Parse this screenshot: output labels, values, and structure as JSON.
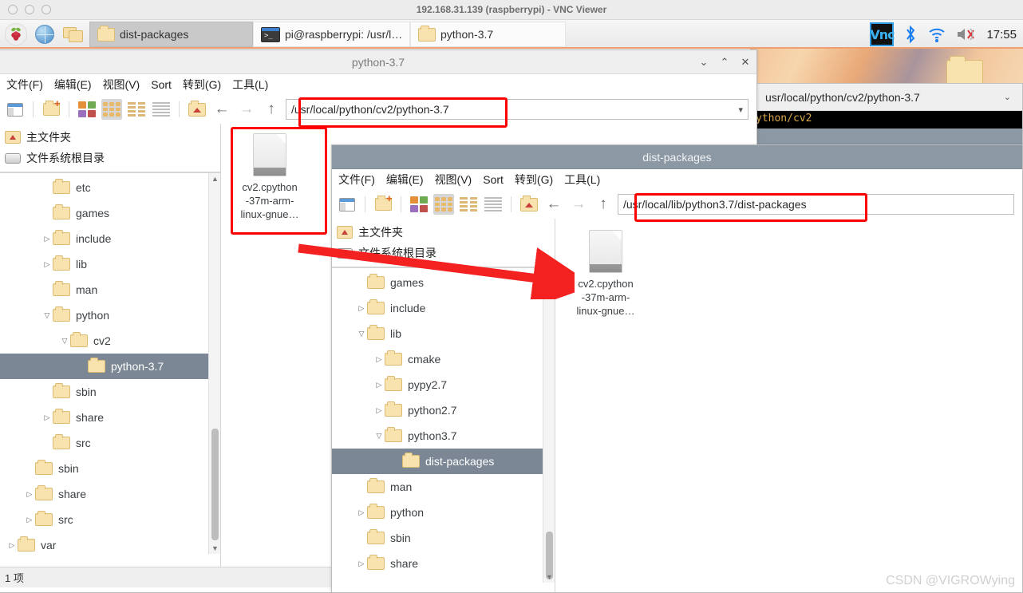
{
  "vnc": {
    "title": "192.168.31.139 (raspberrypi) - VNC Viewer",
    "dot_labels": [
      "minimize",
      "maximize",
      "close"
    ]
  },
  "taskbar": {
    "launchers": [
      {
        "name": "raspberry-menu",
        "icon": "raspberry-icon"
      },
      {
        "name": "web-browser",
        "icon": "globe-icon"
      },
      {
        "name": "file-manager",
        "icon": "folders-icon"
      },
      {
        "name": "terminal",
        "icon": "terminal-icon"
      }
    ],
    "tasks": [
      {
        "label": "dist-packages",
        "icon": "folder-icon",
        "state": "active"
      },
      {
        "label": "pi@raspberrypi: /usr/l…",
        "icon": "terminal-icon",
        "state": "normal"
      },
      {
        "label": "python-3.7",
        "icon": "folder-icon",
        "state": "normal"
      }
    ],
    "tray": {
      "vnc_label": "Vnc",
      "bluetooth_icon": "bluetooth-icon",
      "wifi_icon": "wifi-icon",
      "volume_icon": "volume-muted-icon",
      "clock": "17:55"
    }
  },
  "window_python37": {
    "title": "python-3.7",
    "buttons": {
      "minimize": "⌄",
      "maximize": "⌃",
      "close": "✕"
    },
    "menu": [
      "文件(F)",
      "编辑(E)",
      "视图(V)",
      "Sort",
      "转到(G)",
      "工具(L)"
    ],
    "path": "/usr/local/python/cv2/python-3.7",
    "places": [
      {
        "label": "主文件夹",
        "icon": "home-folder-icon"
      },
      {
        "label": "文件系统根目录",
        "icon": "disk-icon"
      }
    ],
    "tree": [
      {
        "label": "etc",
        "indent": 2,
        "twisty": ""
      },
      {
        "label": "games",
        "indent": 2,
        "twisty": ""
      },
      {
        "label": "include",
        "indent": 2,
        "twisty": "▷"
      },
      {
        "label": "lib",
        "indent": 2,
        "twisty": "▷"
      },
      {
        "label": "man",
        "indent": 2,
        "twisty": ""
      },
      {
        "label": "python",
        "indent": 2,
        "twisty": "▽"
      },
      {
        "label": "cv2",
        "indent": 3,
        "twisty": "▽"
      },
      {
        "label": "python-3.7",
        "indent": 4,
        "twisty": "",
        "selected": true
      },
      {
        "label": "sbin",
        "indent": 2,
        "twisty": ""
      },
      {
        "label": "share",
        "indent": 2,
        "twisty": "▷"
      },
      {
        "label": "src",
        "indent": 2,
        "twisty": ""
      },
      {
        "label": "sbin",
        "indent": 1,
        "twisty": ""
      },
      {
        "label": "share",
        "indent": 1,
        "twisty": "▷"
      },
      {
        "label": "src",
        "indent": 1,
        "twisty": "▷"
      },
      {
        "label": "var",
        "indent": 0,
        "twisty": "▷"
      }
    ],
    "file": {
      "name_lines": [
        "cv2.cpython",
        "-37m-arm-",
        "linux-gnue…"
      ],
      "icon": "document-icon"
    },
    "status": "1 项"
  },
  "window_dist_packages": {
    "title": "dist-packages",
    "menu": [
      "文件(F)",
      "编辑(E)",
      "视图(V)",
      "Sort",
      "转到(G)",
      "工具(L)"
    ],
    "path": "/usr/local/lib/python3.7/dist-packages",
    "places": [
      {
        "label": "主文件夹",
        "icon": "home-folder-icon"
      },
      {
        "label": "文件系统根目录",
        "icon": "disk-icon"
      }
    ],
    "tree": [
      {
        "label": "games",
        "indent": 1,
        "twisty": ""
      },
      {
        "label": "include",
        "indent": 1,
        "twisty": "▷"
      },
      {
        "label": "lib",
        "indent": 1,
        "twisty": "▽"
      },
      {
        "label": "cmake",
        "indent": 2,
        "twisty": "▷"
      },
      {
        "label": "pypy2.7",
        "indent": 2,
        "twisty": "▷"
      },
      {
        "label": "python2.7",
        "indent": 2,
        "twisty": "▷"
      },
      {
        "label": "python3.7",
        "indent": 2,
        "twisty": "▽"
      },
      {
        "label": "dist-packages",
        "indent": 3,
        "twisty": "",
        "selected": true
      },
      {
        "label": "man",
        "indent": 1,
        "twisty": ""
      },
      {
        "label": "python",
        "indent": 1,
        "twisty": "▷"
      },
      {
        "label": "sbin",
        "indent": 1,
        "twisty": ""
      },
      {
        "label": "share",
        "indent": 1,
        "twisty": "▷"
      }
    ],
    "file": {
      "name_lines": [
        "cv2.cpython",
        "-37m-arm-",
        "linux-gnue…"
      ],
      "icon": "document-icon"
    }
  },
  "background_window": {
    "path": "usr/local/python/cv2/python-3.7",
    "caret": "⌄",
    "terminal_text": "ython/cv2"
  },
  "watermark": "CSDN @VIGROWying",
  "colors": {
    "annotation_red": "#ff0000",
    "selection_gray": "#7b8794",
    "taskbar_accent": "#f0a070",
    "folder_yellow": "#f8e2ae"
  }
}
